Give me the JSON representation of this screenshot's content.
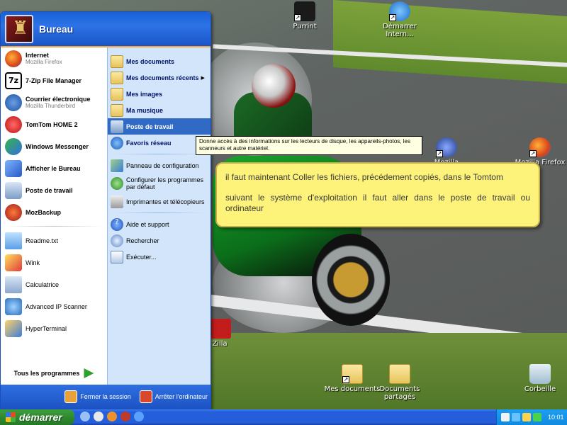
{
  "start_menu": {
    "user": "Bureau",
    "pinned": [
      {
        "title": "Internet",
        "subtitle": "Mozilla Firefox"
      },
      {
        "title": "7-Zip File Manager",
        "subtitle": ""
      },
      {
        "title": "Courrier électronique",
        "subtitle": "Mozilla Thunderbird"
      },
      {
        "title": "TomTom HOME 2",
        "subtitle": ""
      },
      {
        "title": "Windows Messenger",
        "subtitle": ""
      },
      {
        "title": "Afficher le Bureau",
        "subtitle": ""
      },
      {
        "title": "Poste de travail",
        "subtitle": ""
      },
      {
        "title": "MozBackup",
        "subtitle": ""
      }
    ],
    "recent": [
      "Readme.txt",
      "Wink",
      "Calculatrice",
      "Advanced IP Scanner",
      "HyperTerminal"
    ],
    "all_programs": "Tous les programmes",
    "right": {
      "mes_documents": "Mes documents",
      "recents": "Mes documents récents",
      "images": "Mes images",
      "musique": "Ma musique",
      "poste": "Poste de travail",
      "reseau": "Favoris réseau",
      "panneau": "Panneau de configuration",
      "programmes_defaut": "Configurer les programmes par défaut",
      "imprimantes": "Imprimantes et télécopieurs",
      "aide": "Aide et support",
      "rechercher": "Rechercher",
      "executer": "Exécuter..."
    },
    "footer": {
      "logoff": "Fermer la session",
      "shutdown": "Arrêter l'ordinateur"
    }
  },
  "tooltip": "Donne accès à des informations sur les lecteurs de disque, les appareils-photos, les scanneurs et autre matériel.",
  "callout": {
    "line1": "il faut maintenant Coller les fichiers, précédement copiés, dans le Tomtom",
    "line2": "suivant le système d'exploitation il faut aller dans le poste de travail   ou ordinateur"
  },
  "desktop_icons": {
    "purrint": "Purrint",
    "ie": "Démarrer Intern...",
    "mozilla": "Mozilla",
    "firefox": "Mozilla Firefox",
    "zilla": "Zilla",
    "mesdocs": "Mes documents",
    "docpartages": "Documents partagés",
    "corbeille": "Corbeille"
  },
  "taskbar": {
    "start": "démarrer",
    "clock": "10:01"
  },
  "colors": {
    "accent": "#245edb",
    "start_green": "#2f8a2f",
    "callout_yellow": "#fdf37b",
    "selection": "#316ac5"
  }
}
